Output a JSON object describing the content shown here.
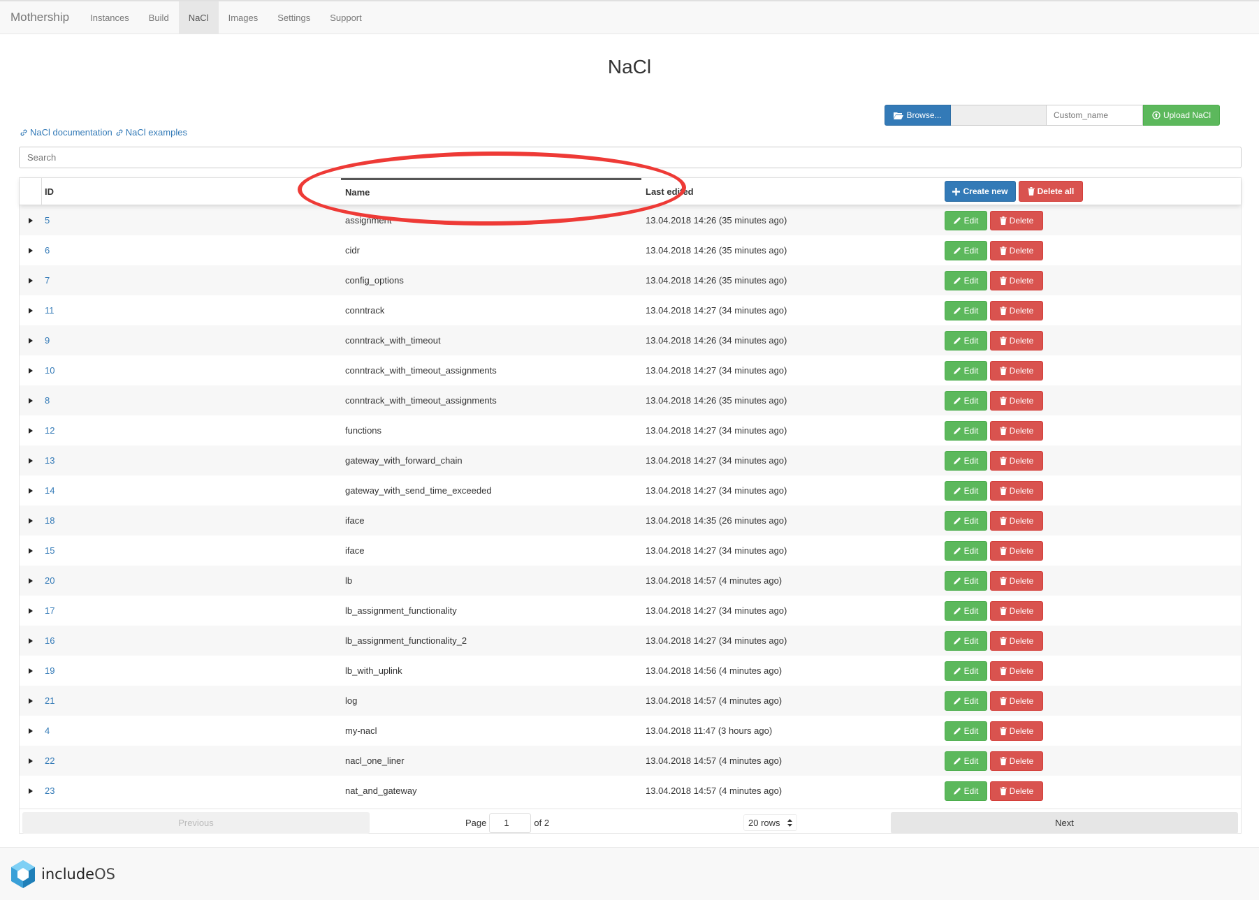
{
  "navbar": {
    "brand": "Mothership",
    "items": [
      {
        "label": "Instances",
        "active": false
      },
      {
        "label": "Build",
        "active": false
      },
      {
        "label": "NaCl",
        "active": true
      },
      {
        "label": "Images",
        "active": false
      },
      {
        "label": "Settings",
        "active": false
      },
      {
        "label": "Support",
        "active": false
      }
    ]
  },
  "page": {
    "title": "NaCl"
  },
  "upload": {
    "browse_label": "Browse...",
    "custom_name_placeholder": "Custom_name",
    "upload_label": "Upload NaCl"
  },
  "links": {
    "documentation": "NaCl documentation",
    "examples": "NaCl examples"
  },
  "search": {
    "placeholder": "Search"
  },
  "table": {
    "headers": {
      "id": "ID",
      "name": "Name",
      "last_edited": "Last edited"
    },
    "create_new_label": "Create new",
    "delete_all_label": "Delete all",
    "edit_label": "Edit",
    "delete_label": "Delete",
    "rows": [
      {
        "id": "5",
        "name": "assignment",
        "last_edited": "13.04.2018 14:26 (35 minutes ago)"
      },
      {
        "id": "6",
        "name": "cidr",
        "last_edited": "13.04.2018 14:26 (35 minutes ago)"
      },
      {
        "id": "7",
        "name": "config_options",
        "last_edited": "13.04.2018 14:26 (35 minutes ago)"
      },
      {
        "id": "11",
        "name": "conntrack",
        "last_edited": "13.04.2018 14:27 (34 minutes ago)"
      },
      {
        "id": "9",
        "name": "conntrack_with_timeout",
        "last_edited": "13.04.2018 14:26 (34 minutes ago)"
      },
      {
        "id": "10",
        "name": "conntrack_with_timeout_assignments",
        "last_edited": "13.04.2018 14:27 (34 minutes ago)"
      },
      {
        "id": "8",
        "name": "conntrack_with_timeout_assignments",
        "last_edited": "13.04.2018 14:26 (35 minutes ago)"
      },
      {
        "id": "12",
        "name": "functions",
        "last_edited": "13.04.2018 14:27 (34 minutes ago)"
      },
      {
        "id": "13",
        "name": "gateway_with_forward_chain",
        "last_edited": "13.04.2018 14:27 (34 minutes ago)"
      },
      {
        "id": "14",
        "name": "gateway_with_send_time_exceeded",
        "last_edited": "13.04.2018 14:27 (34 minutes ago)"
      },
      {
        "id": "18",
        "name": "iface",
        "last_edited": "13.04.2018 14:35 (26 minutes ago)"
      },
      {
        "id": "15",
        "name": "iface",
        "last_edited": "13.04.2018 14:27 (34 minutes ago)"
      },
      {
        "id": "20",
        "name": "lb",
        "last_edited": "13.04.2018 14:57 (4 minutes ago)"
      },
      {
        "id": "17",
        "name": "lb_assignment_functionality",
        "last_edited": "13.04.2018 14:27 (34 minutes ago)"
      },
      {
        "id": "16",
        "name": "lb_assignment_functionality_2",
        "last_edited": "13.04.2018 14:27 (34 minutes ago)"
      },
      {
        "id": "19",
        "name": "lb_with_uplink",
        "last_edited": "13.04.2018 14:56 (4 minutes ago)"
      },
      {
        "id": "21",
        "name": "log",
        "last_edited": "13.04.2018 14:57 (4 minutes ago)"
      },
      {
        "id": "4",
        "name": "my-nacl",
        "last_edited": "13.04.2018 11:47 (3 hours ago)"
      },
      {
        "id": "22",
        "name": "nacl_one_liner",
        "last_edited": "13.04.2018 14:57 (4 minutes ago)"
      },
      {
        "id": "23",
        "name": "nat_and_gateway",
        "last_edited": "13.04.2018 14:57 (4 minutes ago)"
      }
    ]
  },
  "pagination": {
    "previous_label": "Previous",
    "next_label": "Next",
    "page_label": "Page",
    "current_page": "1",
    "of_label": "of 2",
    "rows_label": "20 rows"
  },
  "footer": {
    "logo_text_a": "include",
    "logo_text_b": "OS"
  },
  "colors": {
    "primary": "#337ab7",
    "success": "#5cb85c",
    "danger": "#d9534f",
    "annotation": "#ee3a36"
  }
}
